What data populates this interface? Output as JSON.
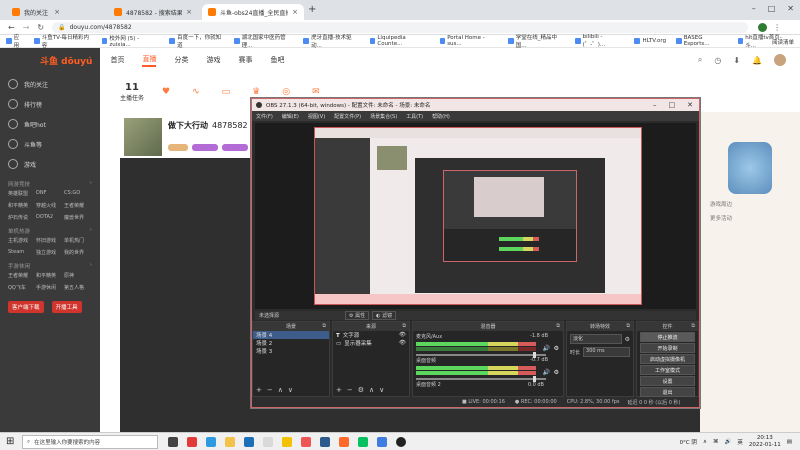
{
  "browser": {
    "tabs": [
      {
        "label": "我的关注 - 斗鱼"
      },
      {
        "label": "4878582 - 搜索结果 - 斗鱼直播"
      },
      {
        "label": "斗鱼-obs24直播_全民直播_斗鱼直..."
      }
    ],
    "url": "douyu.com/4878582",
    "bookmarks": [
      "应用",
      "斗鱼TV-每日精彩内容",
      "校外网 (5) - zuixia...",
      "百度一下，你就知道",
      "湖北国家中医药管理...",
      "虎牙直播-技术驱动...",
      "Liquipedia Counte...",
      "Portal Home - sus...",
      "学堂在线_精品中国...",
      "bilibili - (゜-゜)...",
      "HLTV.org",
      "BASEG Esports...",
      "hlt直播tv首页-斗..."
    ],
    "bookmarks_right": "阅读清单"
  },
  "douyu": {
    "logo": "斗鱼 dōuyú",
    "nav": [
      "首页",
      "直播",
      "分类",
      "游戏",
      "赛事",
      "鱼吧"
    ],
    "nav_active_index": 1,
    "sidebar_items": [
      "我的关注",
      "排行榜",
      "鱼吧hot",
      "斗鱼等",
      "游戏"
    ],
    "sidebar_section_1": "网游竞技",
    "sidebar_section_2": "单机热游",
    "sidebar_section_3": "手游休闲",
    "sidebar_grid_1": [
      "英雄联盟",
      "DNF",
      "CS:GO",
      "和平精英",
      "穿越火线",
      "王者荣耀",
      "炉石传说",
      "DOTA2",
      "魔兽世界"
    ],
    "sidebar_grid_2": [
      "主机游戏",
      "怀旧游戏",
      "单机热门",
      "Steam",
      "独立游戏",
      "我的世界"
    ],
    "sidebar_grid_3": [
      "王者荣耀",
      "和平精英",
      "原神",
      "QQ飞车",
      "手游休闲",
      "第五人格"
    ],
    "sidebar_buttons": [
      "客户端下载",
      "开播工具"
    ],
    "streamer_name": "做下大行动",
    "room_id": "4878582",
    "viewer_count": "11",
    "subnav_label": "主播任务",
    "right_panel": [
      "游戏周边",
      "更多活动"
    ]
  },
  "obs": {
    "title": "OBS 27.1.3 (64-bit, windows) - 配置文件: 未命名 - 场景: 未命名",
    "menu": [
      "文件(F)",
      "编辑(E)",
      "视图(V)",
      "配置文件(P)",
      "场景集合(S)",
      "工具(T)",
      "帮助(H)"
    ],
    "preview_label": "未选择源",
    "preview_buttons": [
      "属性",
      "滤镜"
    ],
    "panels": {
      "scenes": {
        "title": "场景",
        "items": [
          "场景 4",
          "场景 2",
          "场景 3"
        ]
      },
      "sources": {
        "title": "来源",
        "items": [
          "文字源",
          "显示器采集"
        ]
      },
      "mixer": {
        "title": "混音器",
        "tracks": [
          {
            "name": "麦克风/Aux",
            "db": "-1.8 dB"
          },
          {
            "name": "桌面音频",
            "db": "-0.7 dB"
          }
        ],
        "footer_name": "桌面音频 2",
        "footer_db": "0.0 dB"
      },
      "transitions": {
        "title": "转场特效",
        "type": "淡化",
        "duration_label": "时长",
        "duration": "300 ms"
      },
      "controls": {
        "title": "控件",
        "buttons": [
          "停止推流",
          "开始录制",
          "启动虚拟摄像机",
          "工作室模式",
          "设置",
          "退出"
        ]
      }
    },
    "status": {
      "dropped": "丢帧 0 (0.0%)",
      "live": "LIVE: 00:00:16",
      "rec": "REC: 00:00:00",
      "cpu": "CPU: 2.8%, 30.00 fps",
      "kbps": "延迟 0 0 秒 (以后 0 秒)"
    }
  },
  "taskbar": {
    "search_placeholder": "在这里输入你要搜索的内容",
    "weather": "0°C 阴",
    "language": "英",
    "time": "20:13",
    "date": "2022-01-11"
  },
  "colors": {
    "douyu_orange": "#ff5d23",
    "obs_bg": "#2b2b2b",
    "sidebar_bg": "#3a3a3a"
  }
}
